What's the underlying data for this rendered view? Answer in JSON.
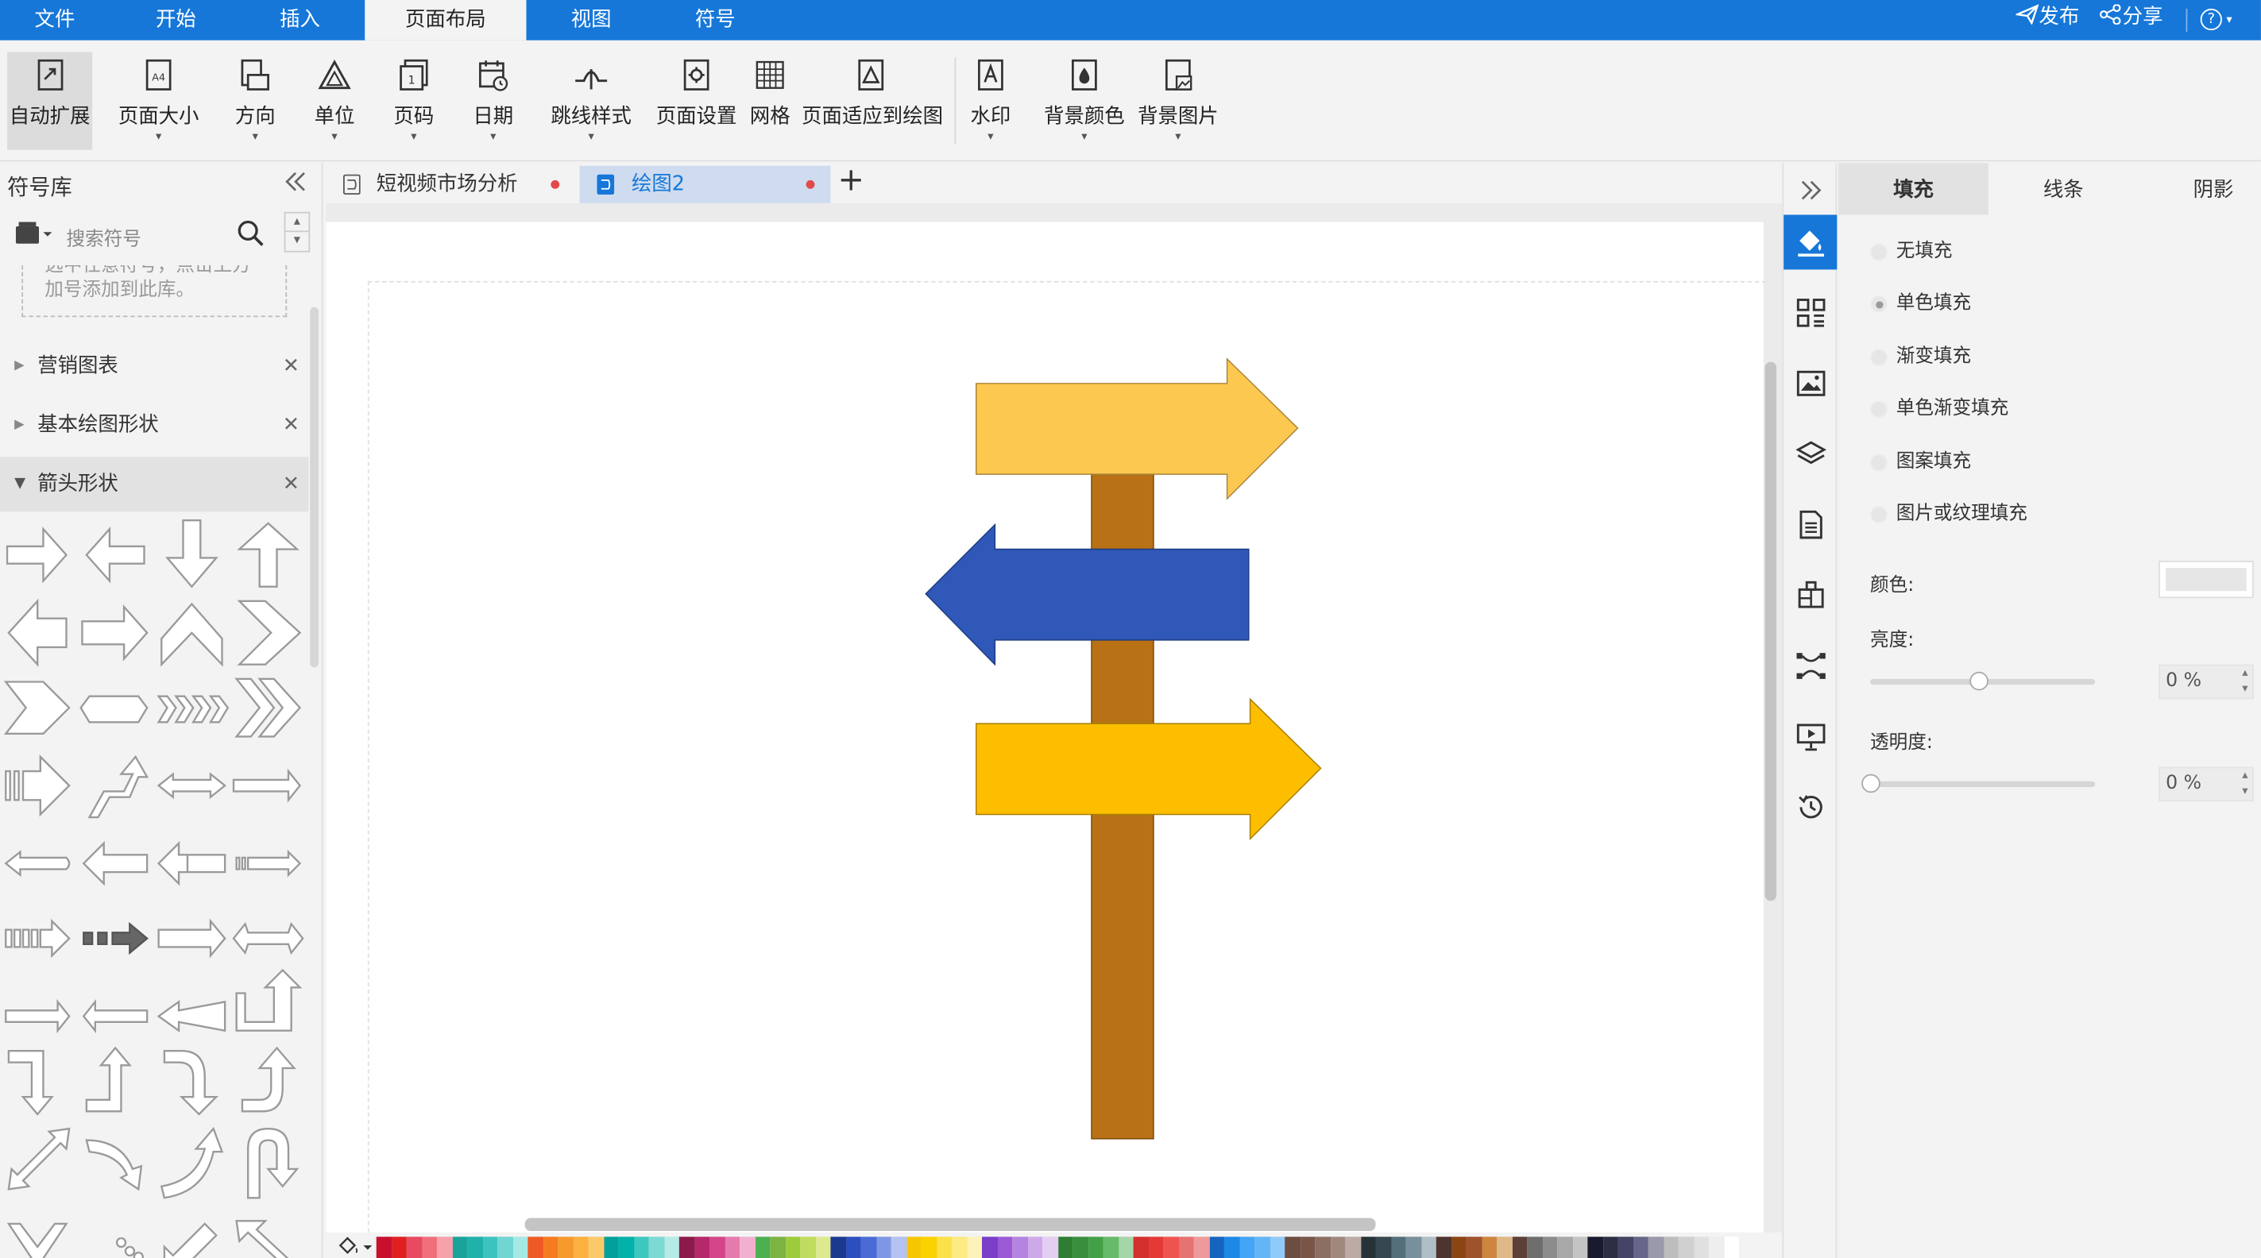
{
  "menu": {
    "tabs": [
      {
        "label": "文件"
      },
      {
        "label": "开始"
      },
      {
        "label": "插入"
      },
      {
        "label": "页面布局"
      },
      {
        "label": "视图"
      },
      {
        "label": "符号"
      }
    ],
    "active_tab": "页面布局",
    "publish": "发布",
    "share": "分享",
    "help": "?"
  },
  "toolbar": {
    "auto_expand": "自动扩展",
    "page_size": "页面大小",
    "orientation": "方向",
    "unit": "单位",
    "page_number": "页码",
    "date": "日期",
    "jump_style": "跳线样式",
    "page_setup": "页面设置",
    "grid": "网格",
    "fit_page": "页面适应到绘图",
    "watermark": "水印",
    "bg_color": "背景颜色",
    "bg_image": "背景图片",
    "page_size_icon_text": "A4",
    "page_number_icon_text": "1"
  },
  "library": {
    "title": "符号库",
    "search_placeholder": "搜索符号",
    "hint": "选中任意符号，点击上方加号添加到此库。",
    "hint_line1": "选中任意符号，点击上方",
    "hint_line2": "加号添加到此库。",
    "sections": [
      {
        "label": "营销图表",
        "expanded": false
      },
      {
        "label": "基本绘图形状",
        "expanded": false
      },
      {
        "label": "箭头形状",
        "expanded": true
      }
    ]
  },
  "documents": {
    "tabs": [
      {
        "label": "短视频市场分析",
        "active": false
      },
      {
        "label": "绘图2",
        "active": true
      }
    ],
    "add": "+"
  },
  "format_panel": {
    "tabs": [
      {
        "label": "填充",
        "active": true
      },
      {
        "label": "线条",
        "active": false
      },
      {
        "label": "阴影",
        "active": false
      }
    ],
    "fill_options": [
      {
        "label": "无填充",
        "selected": false
      },
      {
        "label": "单色填充",
        "selected": true
      },
      {
        "label": "渐变填充",
        "selected": false
      },
      {
        "label": "单色渐变填充",
        "selected": false
      },
      {
        "label": "图案填充",
        "selected": false
      },
      {
        "label": "图片或纹理填充",
        "selected": false
      }
    ],
    "color_label": "颜色:",
    "brightness_label": "亮度:",
    "brightness_value": "0 %",
    "brightness_level": 0.5,
    "transparency_label": "透明度:",
    "transparency_value": "0 %",
    "transparency_level": 0.0,
    "color_swatch": "#e6e6e6"
  },
  "drawing": {
    "colors": {
      "post": "#b87215",
      "arrow_top": "#fcc84f",
      "arrow_middle": "#2f58b8",
      "arrow_bottom": "#fdbe00"
    }
  },
  "accent": "#1677d9",
  "palette_colors": [
    "#c8102e",
    "#e02020",
    "#e84a5f",
    "#f06f7a",
    "#f7a1a8",
    "#1aa39a",
    "#20b2aa",
    "#3cc3c0",
    "#6fd6d2",
    "#a6e8e4",
    "#ef5a24",
    "#f47b20",
    "#f79a2e",
    "#fbb040",
    "#fcc96a",
    "#00a19a",
    "#00b2a9",
    "#3cc8bf",
    "#7cd9d3",
    "#b5ebe7",
    "#8b1a4a",
    "#b5286a",
    "#d4458a",
    "#e57bad",
    "#f1b0cf",
    "#4caf50",
    "#7cb342",
    "#9ccc3c",
    "#c0dc5e",
    "#dce98f",
    "#1a3a8f",
    "#2c4fbf",
    "#4a6bd6",
    "#7e96e4",
    "#b3c2f0",
    "#f7c600",
    "#fad200",
    "#fbe04a",
    "#fcea84",
    "#fdf3ba",
    "#7a3ec9",
    "#9b59d6",
    "#b583e0",
    "#cda9ea",
    "#e4cef4",
    "#2e7d32",
    "#388e3c",
    "#43a047",
    "#66bb6a",
    "#a5d6a7",
    "#d32f2f",
    "#e53935",
    "#ef5350",
    "#e57373",
    "#ef9a9a",
    "#1565c0",
    "#1e88e5",
    "#42a5f5",
    "#64b5f6",
    "#90caf9",
    "#6d4c41",
    "#795548",
    "#8d6e63",
    "#a1887f",
    "#bcaaa4",
    "#263238",
    "#37474f",
    "#546e7a",
    "#78909c",
    "#b0bec5",
    "#4e342e",
    "#8b4513",
    "#a0522d",
    "#cd853f",
    "#deb887",
    "#5d4037",
    "#6e6e6e",
    "#8c8c8c",
    "#a8a8a8",
    "#c4c4c4",
    "#1a1a2e",
    "#2d2d44",
    "#444466",
    "#666688",
    "#9999aa",
    "#bdbdbd",
    "#d0d0d0",
    "#e0e0e0",
    "#eeeeee",
    "#ffffff"
  ]
}
